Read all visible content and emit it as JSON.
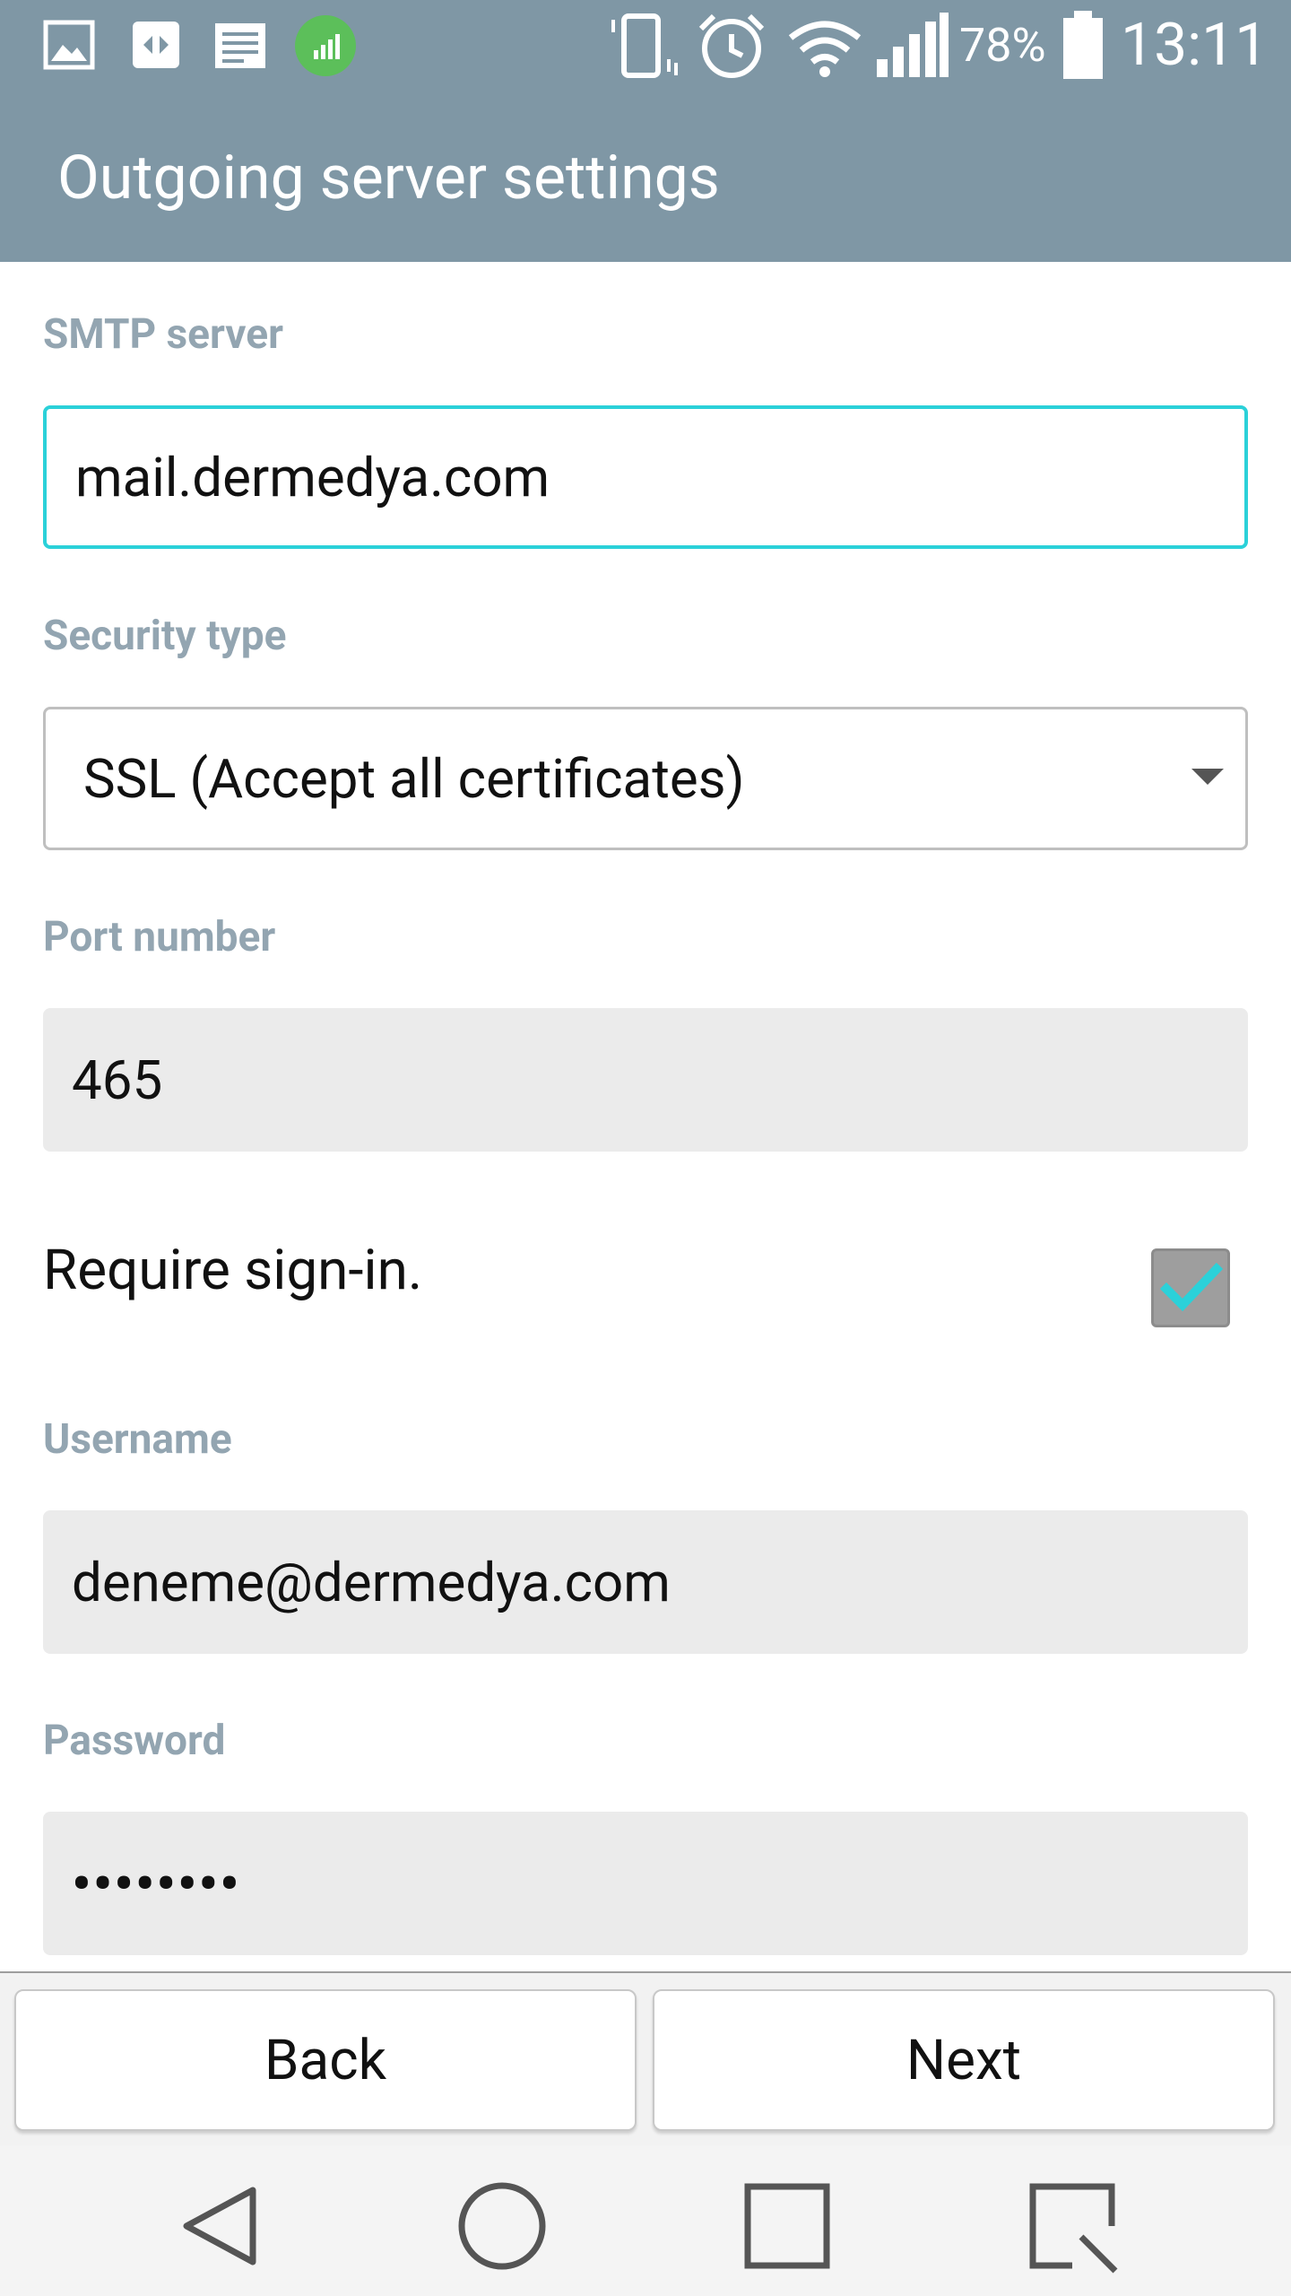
{
  "status_bar": {
    "notification_icons": [
      "image-icon",
      "flipboard-icon",
      "document-icon",
      "signal-app-icon"
    ],
    "system_icons": [
      "vibrate-icon",
      "alarm-icon",
      "wifi-icon",
      "cell-signal-icon",
      "battery-icon"
    ],
    "battery": "78%",
    "time": "13:11"
  },
  "app_bar": {
    "title": "Outgoing server settings"
  },
  "form": {
    "smtp_server": {
      "label": "SMTP server",
      "value": "mail.dermedya.com"
    },
    "security_type": {
      "label": "Security type",
      "value": "SSL (Accept all certificates)"
    },
    "port_number": {
      "label": "Port number",
      "value": "465"
    },
    "require_signin": {
      "label": "Require sign-in.",
      "checked": true
    },
    "username": {
      "label": "Username",
      "value": "deneme@dermedya.com"
    },
    "password": {
      "label": "Password",
      "value": "••••••••"
    }
  },
  "buttons": {
    "back": "Back",
    "next": "Next"
  },
  "nav_bar": {
    "icons": [
      "back-icon",
      "home-icon",
      "recents-icon",
      "quick-memo-icon"
    ]
  },
  "colors": {
    "header": "#7f97a5",
    "label": "#93a5b1",
    "focus_border": "#2bd1d9",
    "field_fill": "#ebebeb",
    "check_mark": "#2bd1d9"
  }
}
